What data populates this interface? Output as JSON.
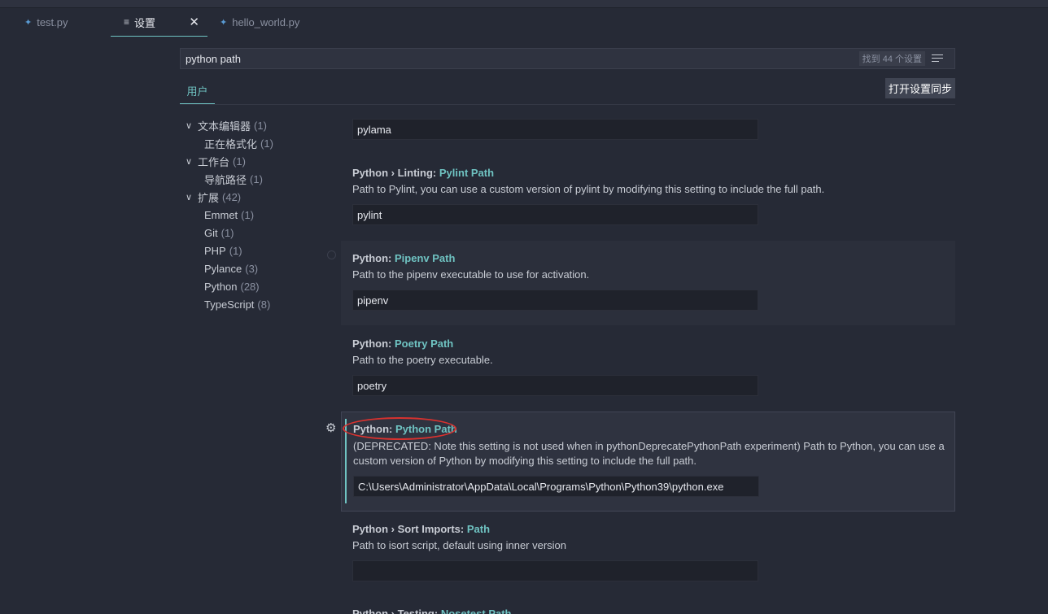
{
  "tabs": [
    {
      "label": "test.py",
      "icon": "python-file-icon"
    },
    {
      "label": "设置",
      "icon": "settings-doc-icon",
      "active": true
    },
    {
      "label": "hello_world.py",
      "icon": "python-file-icon"
    }
  ],
  "search": {
    "value": "python path",
    "count": "找到 44 个设置"
  },
  "scope": {
    "user_tab": "用户",
    "sync_button": "打开设置同步"
  },
  "toc": [
    {
      "label": "文本编辑器",
      "count": "(1)",
      "level": 0
    },
    {
      "label": "正在格式化",
      "count": "(1)",
      "level": 1
    },
    {
      "label": "工作台",
      "count": "(1)",
      "level": 0
    },
    {
      "label": "导航路径",
      "count": "(1)",
      "level": 1
    },
    {
      "label": "扩展",
      "count": "(42)",
      "level": 0
    },
    {
      "label": "Emmet",
      "count": "(1)",
      "level": 1
    },
    {
      "label": "Git",
      "count": "(1)",
      "level": 1
    },
    {
      "label": "PHP",
      "count": "(1)",
      "level": 1
    },
    {
      "label": "Pylance",
      "count": "(3)",
      "level": 1
    },
    {
      "label": "Python",
      "count": "(28)",
      "level": 1
    },
    {
      "label": "TypeScript",
      "count": "(8)",
      "level": 1
    }
  ],
  "settings": {
    "pylama": {
      "value": "pylama"
    },
    "pylint": {
      "prefix": "Python › Linting: ",
      "key": "Pylint Path",
      "desc": "Path to Pylint, you can use a custom version of pylint by modifying this setting to include the full path.",
      "value": "pylint"
    },
    "pipenv": {
      "prefix": "Python: ",
      "key": "Pipenv Path",
      "desc": "Path to the pipenv executable to use for activation.",
      "value": "pipenv"
    },
    "poetry": {
      "prefix": "Python: ",
      "key": "Poetry Path",
      "desc": "Path to the poetry executable.",
      "value": "poetry"
    },
    "python": {
      "prefix": "Python: ",
      "key": "Python Path",
      "desc": "(DEPRECATED: Note this setting is not used when in pythonDeprecatePythonPath experiment) Path to Python, you can use a custom version of Python by modifying this setting to include the full path.",
      "value": "C:\\Users\\Administrator\\AppData\\Local\\Programs\\Python\\Python39\\python.exe"
    },
    "isort": {
      "prefix": "Python › Sort Imports: ",
      "key": "Path",
      "desc": "Path to isort script, default using inner version",
      "value": ""
    },
    "nosetest": {
      "prefix": "Python › Testing: ",
      "key": "Nosetest Path"
    }
  }
}
